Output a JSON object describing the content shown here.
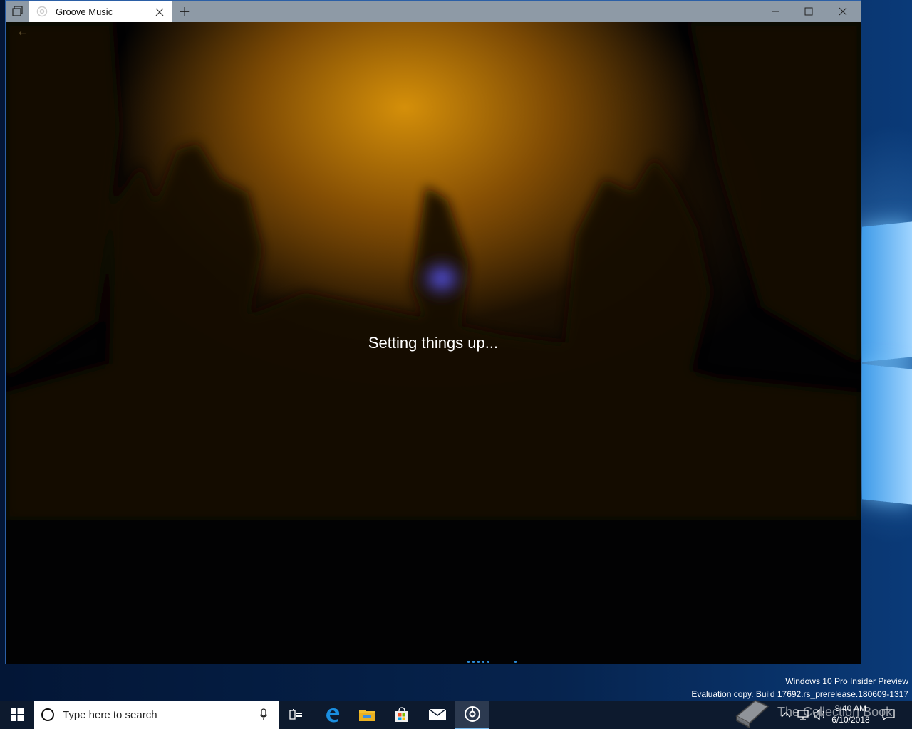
{
  "window": {
    "tab_title": "Groove Music",
    "new_tab_symbol": "+"
  },
  "app": {
    "status_message": "Setting things up..."
  },
  "taskbar": {
    "search_placeholder": "Type here to search",
    "clock_time": "9:40 AM",
    "clock_date": "6/10/2018"
  },
  "desktop": {
    "watermark_line1": "Windows 10 Pro Insider Preview",
    "watermark_line2": "Evaluation copy. Build 17692.rs_prerelease.180609-1317",
    "overlay_text": "The Collection Book"
  },
  "colors": {
    "accent": "#2a8ad8",
    "titlebar": "#8e9aa6",
    "taskbar": "#0d1a2e"
  },
  "icons": [
    "task-view-icon",
    "groove-music-icon",
    "close-icon",
    "new-tab-icon",
    "minimize-icon",
    "maximize-icon",
    "windows-start-icon",
    "cortana-icon",
    "microphone-icon",
    "task-view-taskbar-icon",
    "edge-icon",
    "file-explorer-icon",
    "store-icon",
    "mail-icon",
    "groove-taskbar-icon",
    "chevron-up-icon",
    "network-icon",
    "volume-icon",
    "action-center-icon"
  ]
}
